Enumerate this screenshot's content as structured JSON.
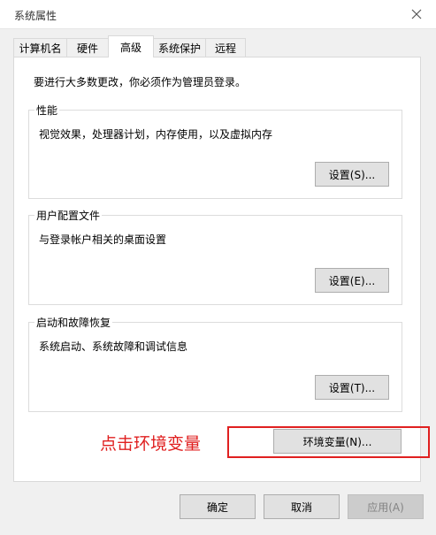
{
  "window": {
    "title": "系统属性"
  },
  "tabs": [
    {
      "label": "计算机名",
      "active": false
    },
    {
      "label": "硬件",
      "active": false
    },
    {
      "label": "高级",
      "active": true
    },
    {
      "label": "系统保护",
      "active": false
    },
    {
      "label": "远程",
      "active": false
    }
  ],
  "advanced": {
    "admin_note": "要进行大多数更改，你必须作为管理员登录。",
    "performance": {
      "title": "性能",
      "description": "视觉效果，处理器计划，内存使用，以及虚拟内存",
      "button": "设置(S)..."
    },
    "user_profiles": {
      "title": "用户配置文件",
      "description": "与登录帐户相关的桌面设置",
      "button": "设置(E)..."
    },
    "startup_recovery": {
      "title": "启动和故障恢复",
      "description": "系统启动、系统故障和调试信息",
      "button": "设置(T)..."
    },
    "env_button": "环境变量(N)..."
  },
  "annotation": {
    "label": "点击环境变量",
    "color": "#e02020"
  },
  "footer": {
    "ok": "确定",
    "cancel": "取消",
    "apply": "应用(A)"
  },
  "icons": {
    "close": "close-icon"
  }
}
